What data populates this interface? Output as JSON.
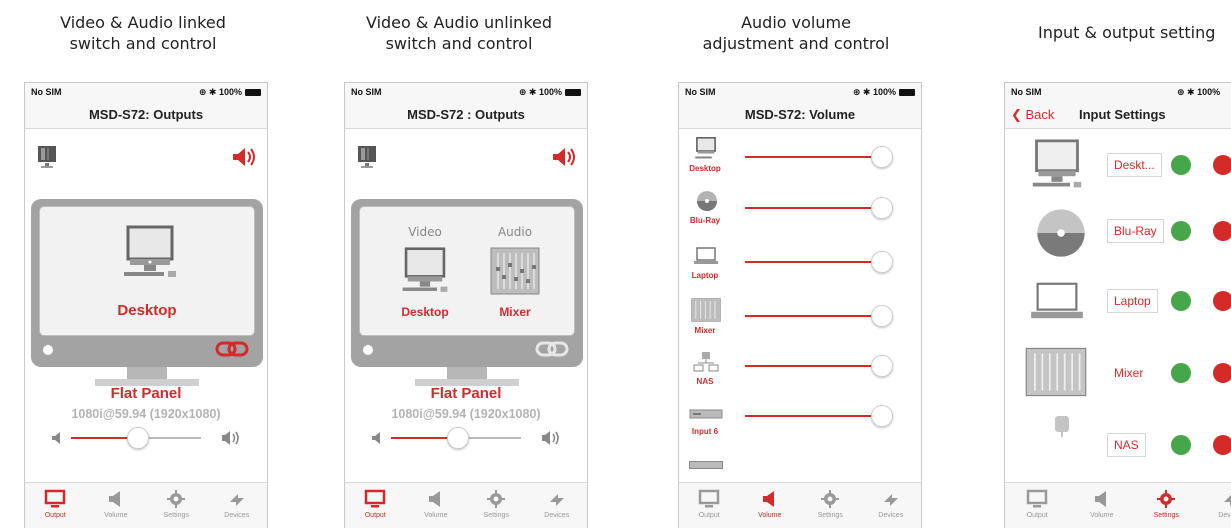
{
  "captions": [
    {
      "line1": "Video & Audio linked",
      "line2": "switch and control"
    },
    {
      "line1": "Video & Audio unlinked",
      "line2": "switch and control"
    },
    {
      "line1": "Audio volume",
      "line2": "adjustment and control"
    },
    {
      "line1": "Input & output setting",
      "line2": ""
    }
  ],
  "status": {
    "carrier": "No SIM",
    "battery": "100%"
  },
  "tabs": [
    "Output",
    "Volume",
    "Settings",
    "Devices"
  ],
  "screen1": {
    "title": "MSD-S72: Outputs",
    "source": "Desktop",
    "output_name": "Flat Panel",
    "resolution": "1080i@59.94 (1920x1080)",
    "volume_level": 0.55
  },
  "screen2": {
    "title": "MSD-S72 : Outputs",
    "video_label": "Video",
    "audio_label": "Audio",
    "video_source": "Desktop",
    "audio_source": "Mixer",
    "output_name": "Flat Panel",
    "resolution": "1080i@59.94 (1920x1080)",
    "volume_level": 0.55
  },
  "screen3": {
    "title": "MSD-S72: Volume",
    "items": [
      {
        "name": "Desktop",
        "icon": "desktop-icon"
      },
      {
        "name": "Blu-Ray",
        "icon": "disc-icon"
      },
      {
        "name": "Laptop",
        "icon": "laptop-icon"
      },
      {
        "name": "Mixer",
        "icon": "mixer-icon"
      },
      {
        "name": "NAS",
        "icon": "nas-icon"
      },
      {
        "name": "Input 6",
        "icon": "device-icon"
      }
    ]
  },
  "screen4": {
    "back": "Back",
    "title": "Input Settings",
    "items": [
      {
        "name": "Deskt...",
        "icon": "desktop-icon"
      },
      {
        "name": "Blu-Ray",
        "icon": "disc-icon"
      },
      {
        "name": "Laptop",
        "icon": "laptop-icon"
      },
      {
        "name": "Mixer",
        "icon": "mixer-icon"
      },
      {
        "name": "NAS",
        "icon": "nas-icon"
      }
    ]
  },
  "colors": {
    "accent": "#d42a2a",
    "ok": "#48a64a"
  }
}
